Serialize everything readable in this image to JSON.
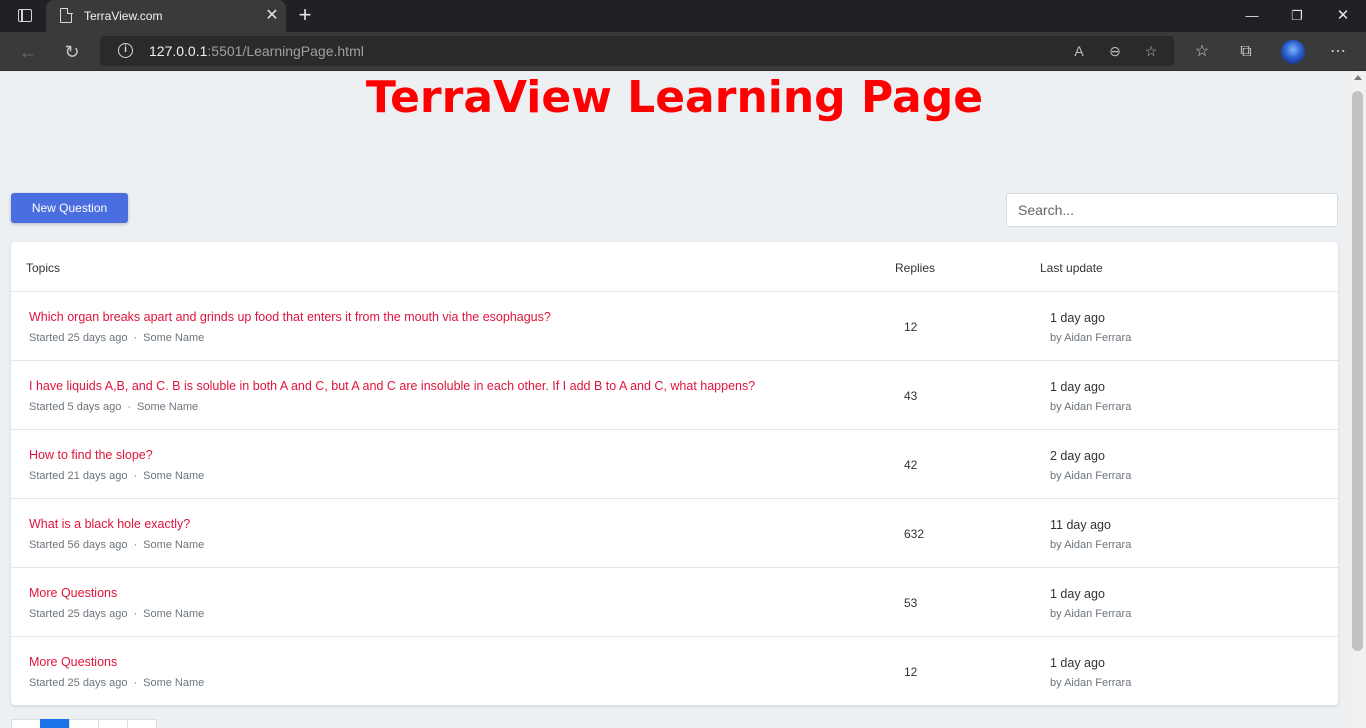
{
  "browser": {
    "tab_title": "TerraView.com",
    "url_host": "127.0.0.1",
    "url_rest": ":5501/LearningPage.html"
  },
  "page": {
    "title": "TerraView Learning Page",
    "new_question_label": "New Question",
    "search_placeholder": "Search..."
  },
  "table": {
    "headers": {
      "topics": "Topics",
      "replies": "Replies",
      "last_update": "Last update"
    },
    "rows": [
      {
        "title": "Which organ breaks apart and grinds up food that enters it from the mouth via the esophagus?",
        "started": "Started 25 days ago",
        "author": "Some Name",
        "replies": "12",
        "updated": "1 day ago",
        "by": "by Aidan Ferrara"
      },
      {
        "title": "I have liquids A,B, and C. B is soluble in both A and C, but A and C are insoluble in each other. If I add B to A and C, what happens?",
        "started": "Started 5 days ago",
        "author": "Some Name",
        "replies": "43",
        "updated": "1 day ago",
        "by": "by Aidan Ferrara"
      },
      {
        "title": "How to find the slope?",
        "started": "Started 21 days ago",
        "author": "Some Name",
        "replies": "42",
        "updated": "2 day ago",
        "by": "by Aidan Ferrara"
      },
      {
        "title": "What is a black hole exactly?",
        "started": "Started 56 days ago",
        "author": "Some Name",
        "replies": "632",
        "updated": "11 day ago",
        "by": "by Aidan Ferrara"
      },
      {
        "title": "More Questions",
        "started": "Started 25 days ago",
        "author": "Some Name",
        "replies": "53",
        "updated": "1 day ago",
        "by": "by Aidan Ferrara"
      },
      {
        "title": "More Questions",
        "started": "Started 25 days ago",
        "author": "Some Name",
        "replies": "12",
        "updated": "1 day ago",
        "by": "by Aidan Ferrara"
      }
    ]
  },
  "colors": {
    "title_red": "#ff0000",
    "link_red": "#e0143c",
    "button_blue": "#4a6ee0",
    "page_bg": "#edf0f3"
  },
  "icons": {
    "tab_actions": "tab-actions-icon",
    "back": "back-arrow-icon",
    "refresh": "refresh-icon",
    "site_info": "info-icon",
    "read_aloud": "read-aloud-icon",
    "zoom": "zoom-out-icon",
    "add_favorite": "add-favorite-icon",
    "favorites": "favorites-icon",
    "collections": "collections-icon",
    "more": "more-icon"
  }
}
